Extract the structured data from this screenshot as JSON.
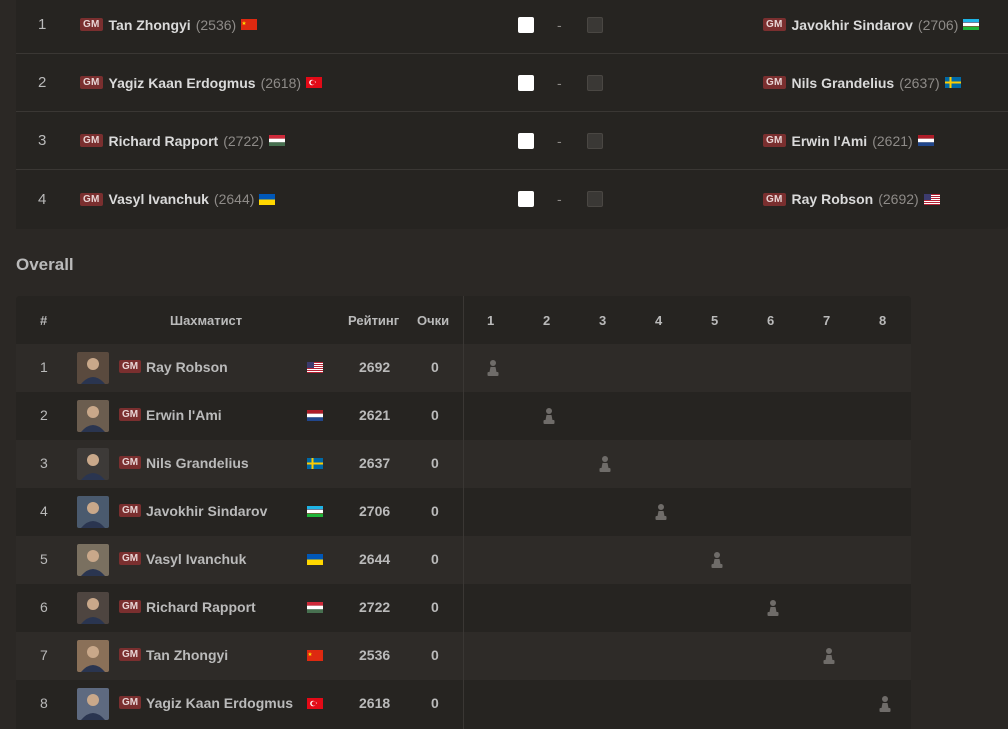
{
  "pairings": [
    {
      "num": "1",
      "white": {
        "title": "GM",
        "name": "Tan Zhongyi",
        "rating": "(2536)",
        "flag": "cn"
      },
      "dash": "-",
      "black": {
        "title": "GM",
        "name": "Javokhir Sindarov",
        "rating": "(2706)",
        "flag": "uz"
      }
    },
    {
      "num": "2",
      "white": {
        "title": "GM",
        "name": "Yagiz Kaan Erdogmus",
        "rating": "(2618)",
        "flag": "tr"
      },
      "dash": "-",
      "black": {
        "title": "GM",
        "name": "Nils Grandelius",
        "rating": "(2637)",
        "flag": "se"
      }
    },
    {
      "num": "3",
      "white": {
        "title": "GM",
        "name": "Richard Rapport",
        "rating": "(2722)",
        "flag": "hu"
      },
      "dash": "-",
      "black": {
        "title": "GM",
        "name": "Erwin l'Ami",
        "rating": "(2621)",
        "flag": "nl"
      }
    },
    {
      "num": "4",
      "white": {
        "title": "GM",
        "name": "Vasyl Ivanchuk",
        "rating": "(2644)",
        "flag": "ua"
      },
      "dash": "-",
      "black": {
        "title": "GM",
        "name": "Ray Robson",
        "rating": "(2692)",
        "flag": "us"
      }
    }
  ],
  "overall": {
    "title": "Overall",
    "headers": {
      "num": "#",
      "player": "Шахматист",
      "rating": "Рейтинг",
      "points": "Очки",
      "rounds": [
        "1",
        "2",
        "3",
        "4",
        "5",
        "6",
        "7",
        "8"
      ]
    },
    "rows": [
      {
        "num": "1",
        "title": "GM",
        "name": "Ray Robson",
        "flag": "us",
        "rating": "2692",
        "points": "0",
        "self_col": 1
      },
      {
        "num": "2",
        "title": "GM",
        "name": "Erwin l'Ami",
        "flag": "nl",
        "rating": "2621",
        "points": "0",
        "self_col": 2
      },
      {
        "num": "3",
        "title": "GM",
        "name": "Nils Grandelius",
        "flag": "se",
        "rating": "2637",
        "points": "0",
        "self_col": 3
      },
      {
        "num": "4",
        "title": "GM",
        "name": "Javokhir Sindarov",
        "flag": "uz",
        "rating": "2706",
        "points": "0",
        "self_col": 4
      },
      {
        "num": "5",
        "title": "GM",
        "name": "Vasyl Ivanchuk",
        "flag": "ua",
        "rating": "2644",
        "points": "0",
        "self_col": 5
      },
      {
        "num": "6",
        "title": "GM",
        "name": "Richard Rapport",
        "flag": "hu",
        "rating": "2722",
        "points": "0",
        "self_col": 6
      },
      {
        "num": "7",
        "title": "GM",
        "name": "Tan Zhongyi",
        "flag": "cn",
        "rating": "2536",
        "points": "0",
        "self_col": 7
      },
      {
        "num": "8",
        "title": "GM",
        "name": "Yagiz Kaan Erdogmus",
        "flag": "tr",
        "rating": "2618",
        "points": "0",
        "self_col": 8
      }
    ]
  },
  "colors": {
    "gm_badge": "#7a2f2f",
    "background": "#2b2825",
    "panel": "#262421",
    "row_alt": "#2e2b28"
  }
}
